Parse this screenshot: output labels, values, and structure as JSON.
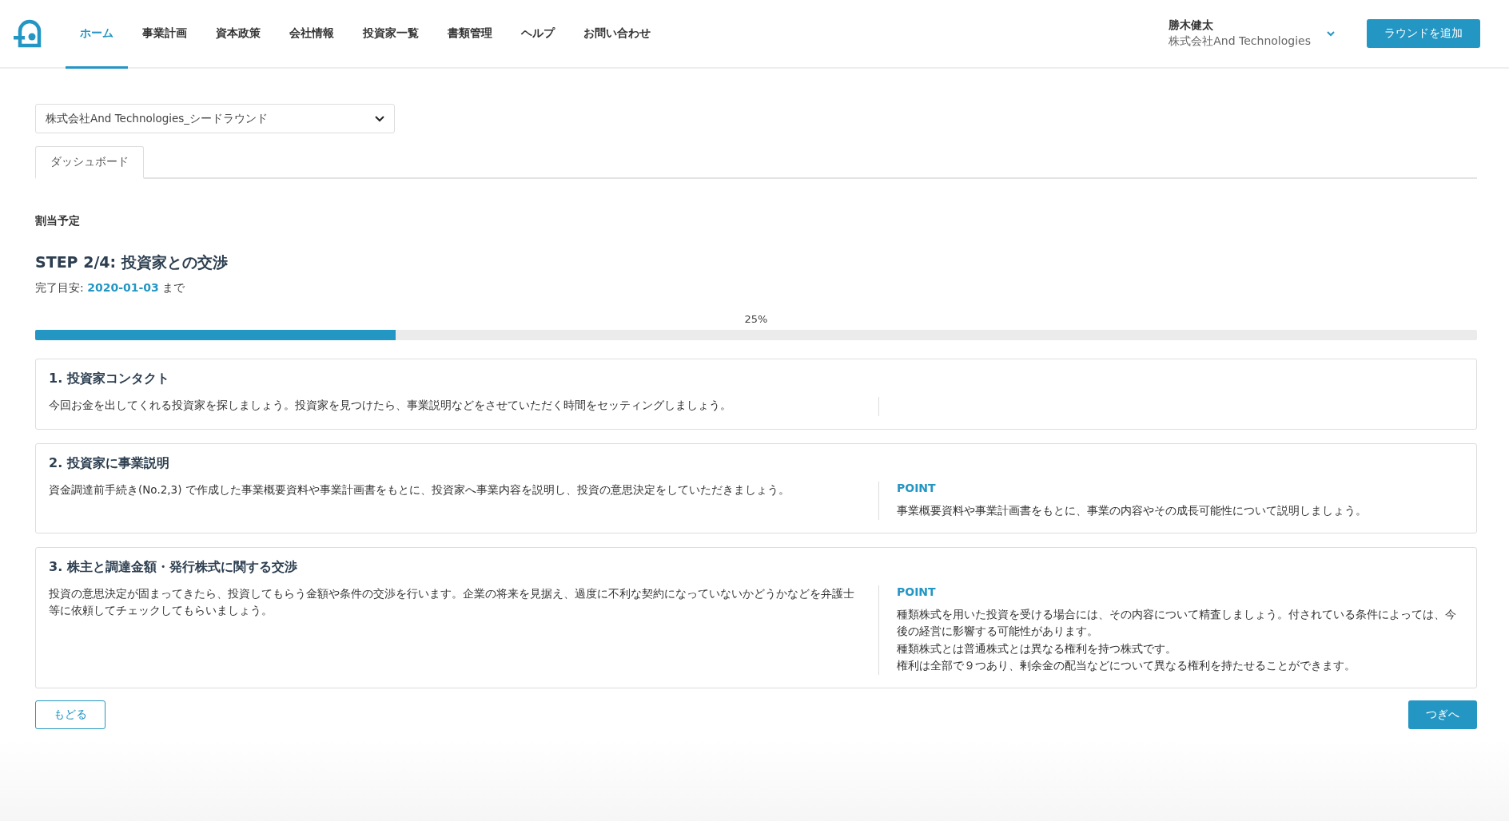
{
  "nav": {
    "items": [
      {
        "label": "ホーム",
        "selected": true
      },
      {
        "label": "事業計画",
        "selected": false
      },
      {
        "label": "資本政策",
        "selected": false
      },
      {
        "label": "会社情報",
        "selected": false
      },
      {
        "label": "投資家一覧",
        "selected": false
      },
      {
        "label": "書類管理",
        "selected": false
      },
      {
        "label": "ヘルプ",
        "selected": false
      },
      {
        "label": "お問い合わせ",
        "selected": false
      }
    ],
    "user": {
      "name": "勝木健太",
      "company": "株式会社And Technologies"
    },
    "add_button": "ラウンドを追加"
  },
  "round_select": {
    "value": "株式会社And Technologies_シードラウンド"
  },
  "tabs": [
    {
      "label": "ダッシュボード",
      "selected": true
    }
  ],
  "section_label": "割当予定",
  "step": {
    "title": "STEP 2/4: 投資家との交渉",
    "deadline_prefix": "完了目安: ",
    "deadline": "2020-01-03",
    "deadline_suffix": " まで",
    "progress_label": "25%",
    "level": 0.25
  },
  "cards": [
    {
      "title": "1. 投資家コンタクト",
      "description": "今回お金を出してくれる投資家を探しましょう。投資家を見つけたら、事業説明などをさせていただく時間をセッティングしましょう。"
    },
    {
      "title": "2. 投資家に事業説明",
      "description": "資金調達前手続き(No.2,3) で作成した事業概要資料や事業計画書をもとに、投資家へ事業内容を説明し、投資の意思決定をしていただきましょう。",
      "point": {
        "label": "POINT",
        "paragraphs": [
          "事業概要資料や事業計画書をもとに、事業の内容やその成長可能性について説明しましょう。"
        ]
      }
    },
    {
      "title": "3. 株主と調達金額・発行株式に関する交渉",
      "description": "投資の意思決定が固まってきたら、投資してもらう金額や条件の交渉を行います。企業の将来を見据え、過度に不利な契約になっていないかどうかなどを弁護士等に依頼してチェックしてもらいましょう。",
      "point": {
        "label": "POINT",
        "paragraphs": [
          "種類株式を用いた投資を受ける場合には、その内容について精査しましょう。付されている条件によっては、今後の経営に影響する可能性があります。",
          "種類株式とは普通株式とは異なる権利を持つ株式です。",
          "権利は全部で９つあり、剰余金の配当などについて異なる権利を持たせることができます。"
        ]
      }
    }
  ],
  "footer": {
    "back": "もどる",
    "next": "つぎへ"
  }
}
